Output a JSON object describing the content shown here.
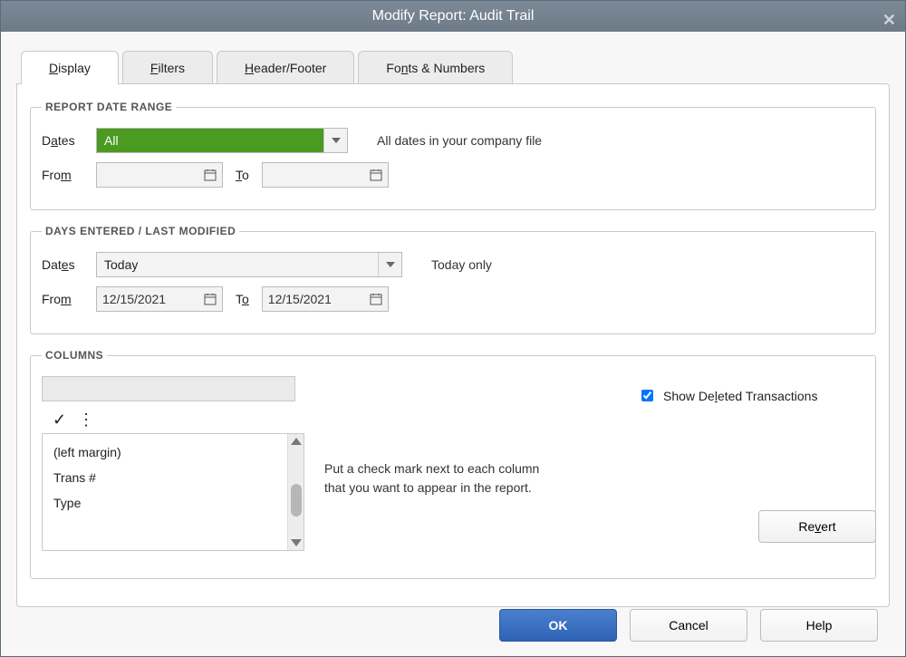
{
  "window": {
    "title": "Modify Report: Audit Trail"
  },
  "tabs": {
    "display": "Display",
    "filters": "Filters",
    "header": "Header/Footer",
    "fonts": "Fonts & Numbers"
  },
  "section_titles": {
    "report_date_range": "REPORT DATE RANGE",
    "days_entered": "DAYS ENTERED / LAST MODIFIED",
    "columns": "COLUMNS"
  },
  "labels": {
    "dates": "Dates",
    "from": "From",
    "to": "To"
  },
  "report_date_range": {
    "dates_value": "All",
    "hint": "All dates in your company file",
    "from": "",
    "to": ""
  },
  "days_entered": {
    "dates_value": "Today",
    "hint": "Today only",
    "from": "12/15/2021",
    "to": "12/15/2021"
  },
  "columns": {
    "items": [
      "(left margin)",
      "Trans #",
      "Type"
    ],
    "hint_line1": "Put a check mark next to each column",
    "hint_line2": "that you want to appear in the report.",
    "sort_glyphs": "✓ ⋮"
  },
  "show_deleted": {
    "checked": true,
    "label": "Show Deleted Transactions"
  },
  "buttons": {
    "revert": "Revert",
    "ok": "OK",
    "cancel": "Cancel",
    "help": "Help"
  }
}
